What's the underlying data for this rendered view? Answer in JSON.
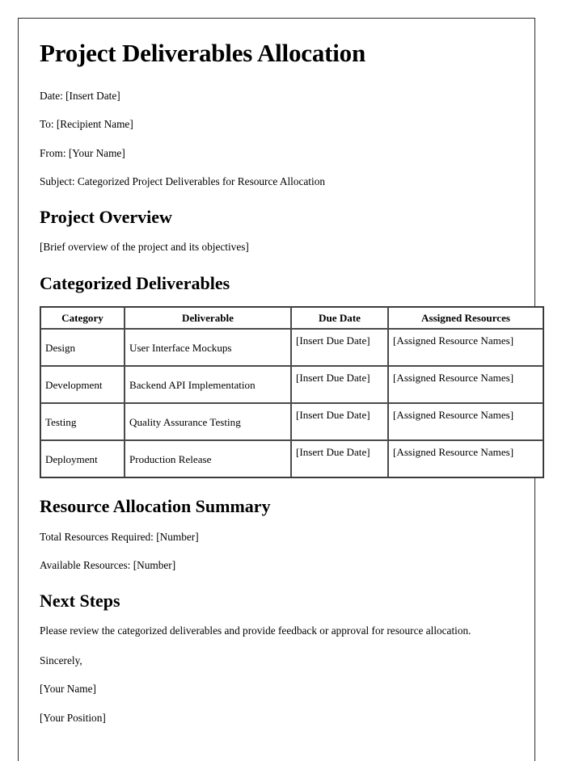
{
  "document": {
    "title": "Project Deliverables Allocation",
    "meta_lines": [
      "Date: [Insert Date]",
      "To: [Recipient Name]",
      "From: [Your Name]",
      "Subject: Categorized Project Deliverables for Resource Allocation"
    ],
    "sections": {
      "project_overview": {
        "heading": "Project Overview",
        "body": "[Brief overview of the project and its objectives]"
      },
      "categorized_deliverables": {
        "heading": "Categorized Deliverables",
        "table": {
          "columns": [
            "Category",
            "Deliverable",
            "Due Date",
            "Assigned Resources"
          ],
          "rows": [
            {
              "category": "Design",
              "deliverable": "User Interface Mockups",
              "due_date": "[Insert Due Date]",
              "assigned_resources": "[Assigned Resource Names]"
            },
            {
              "category": "Development",
              "deliverable": "Backend API Implementation",
              "due_date": "[Insert Due Date]",
              "assigned_resources": "[Assigned Resource Names]"
            },
            {
              "category": "Testing",
              "deliverable": "Quality Assurance Testing",
              "due_date": "[Insert Due Date]",
              "assigned_resources": "[Assigned Resource Names]"
            },
            {
              "category": "Deployment",
              "deliverable": "Production Release",
              "due_date": "[Insert Due Date]",
              "assigned_resources": "[Assigned Resource Names]"
            }
          ]
        }
      },
      "resource_allocation_summary": {
        "heading": "Resource Allocation Summary",
        "total_resources_required": "Total Resources Required: [Number]",
        "available_resources": "Available Resources: [Number]"
      },
      "next_steps": {
        "heading": "Next Steps",
        "body": "Please review the categorized deliverables and provide feedback or approval for resource allocation."
      }
    },
    "signature": {
      "closing": "Sincerely,",
      "name": "[Your Name]",
      "position": "[Your Position]"
    }
  }
}
